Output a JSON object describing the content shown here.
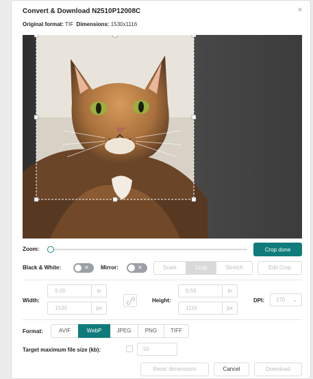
{
  "dialog": {
    "title": "Convert & Download N2510P12008C",
    "close_glyph": "×"
  },
  "meta": {
    "format_label": "Original format:",
    "format_value": "TIF",
    "dimensions_label": "Dimensions:",
    "dimensions_value": "1530x1116"
  },
  "image": {
    "subject": "cat-photo"
  },
  "zoom": {
    "label": "Zoom:",
    "level": 0
  },
  "crop_done_label": "Crop done",
  "black_white": {
    "label": "Black & White:",
    "toggle_glyph": "✕"
  },
  "mirror": {
    "label": "Mirror:",
    "toggle_glyph": "✕"
  },
  "fit_modes": {
    "options": [
      "Scale",
      "Crop",
      "Stretch"
    ],
    "selected": "Crop"
  },
  "edit_crop_label": "Edit Crop",
  "width": {
    "label": "Width:",
    "inches": "9.00",
    "inches_unit": "in",
    "pixels": "1530",
    "pixels_unit": "px"
  },
  "height": {
    "label": "Height:",
    "inches": "6.56",
    "inches_unit": "in",
    "pixels": "1116",
    "pixels_unit": "px"
  },
  "dpi": {
    "label": "DPI:",
    "value": "170",
    "chevron": "⌄"
  },
  "format": {
    "label": "Format:",
    "options": [
      "AVIF",
      "WebP",
      "JPEG",
      "PNG",
      "TIFF"
    ],
    "selected": "WebP"
  },
  "target_size": {
    "label": "Target maximum file size (kb):",
    "value": "50"
  },
  "footer": {
    "reset_label": "Reset dimensions",
    "cancel_label": "Cancel",
    "download_label": "Download"
  },
  "colors": {
    "accent": "#0f7b7a",
    "toggle_off": "#9aa0a6"
  }
}
